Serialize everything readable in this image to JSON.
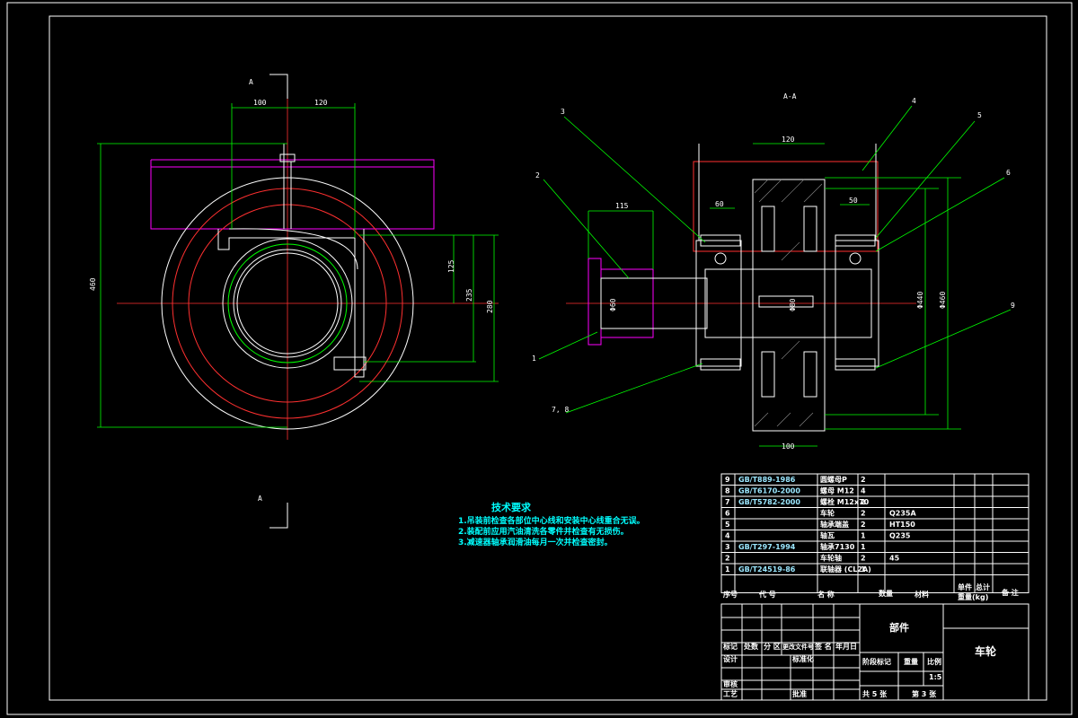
{
  "section_marks": {
    "top": "A",
    "bottom": "A",
    "view_title": "A-A"
  },
  "left_view_dims": {
    "d1": "100",
    "d2": "120",
    "h_total": "460",
    "h1": "125",
    "h2": "235",
    "h3": "280"
  },
  "right_view_dims": {
    "top_width": "120",
    "w_left_brg": "60",
    "w_right_brg": "50",
    "shaft": "115",
    "h_a": "Φ440",
    "h_b": "Φ460",
    "bottom_width": "100",
    "shaft_dia_left": "Φ60",
    "shaft_dia_mid": "Φ80"
  },
  "leaders": [
    "3",
    "4",
    "5",
    "6",
    "2",
    "1",
    "7, 8",
    "9"
  ],
  "tech_requirements": {
    "title": "技术要求",
    "lines": [
      "1.吊装前检查各部位中心线和安装中心线重合无误。",
      "2.装配前应用汽油清洗各零件并检查有无损伤。",
      "3.减速器轴承润滑油每月一次并检查密封。"
    ]
  },
  "bom": {
    "rows": [
      {
        "no": "9",
        "code": "GB/T889-1986",
        "name": "圆螺母P",
        "qty": "2",
        "material": "",
        "weight": "",
        "remark": ""
      },
      {
        "no": "8",
        "code": "GB/T6170-2000",
        "name": "螺母 M12",
        "qty": "4",
        "material": "",
        "weight": "",
        "remark": ""
      },
      {
        "no": "7",
        "code": "GB/T5782-2000",
        "name": "螺栓 M12x70",
        "qty": "2",
        "material": "",
        "weight": "",
        "remark": ""
      },
      {
        "no": "6",
        "code": "",
        "name": "车轮",
        "qty": "2",
        "material": "Q235A",
        "weight": "",
        "remark": ""
      },
      {
        "no": "5",
        "code": "",
        "name": "轴承端盖",
        "qty": "2",
        "material": "HT150",
        "weight": "",
        "remark": ""
      },
      {
        "no": "4",
        "code": "",
        "name": "轴瓦",
        "qty": "1",
        "material": "Q235",
        "weight": "",
        "remark": ""
      },
      {
        "no": "3",
        "code": "GB/T297-1994",
        "name": "轴承7130",
        "qty": "1",
        "material": "",
        "weight": "",
        "remark": ""
      },
      {
        "no": "2",
        "code": "",
        "name": "车轮轴",
        "qty": "2",
        "material": "45",
        "weight": "",
        "remark": ""
      },
      {
        "no": "1",
        "code": "GB/T24519-86",
        "name": "联轴器 (CL2A)",
        "qty": "1",
        "material": "",
        "weight": "",
        "remark": ""
      }
    ],
    "headers": {
      "no": "序号",
      "code": "代 号",
      "name": "名 称",
      "qty": "数量",
      "material": "材料",
      "unit_weight": "单件",
      "total_weight": "总计",
      "weight_label": "重量(kg)",
      "remark": "备 注"
    }
  },
  "title_block": {
    "labels": {
      "mark": "标记",
      "count": "处数",
      "zone": "分 区",
      "doc": "更改文件号",
      "sign": "签 名",
      "date": "年月日",
      "design": "设计",
      "standard": "标准化",
      "review": "审核",
      "process": "工艺",
      "approve": "批准",
      "stage": "阶段标记",
      "weight": "重量",
      "scale": "比例"
    },
    "values": {
      "scale": "1:5",
      "sheet_total": "共 5 张",
      "sheet_no": "第 3 张",
      "part_name": "部件",
      "drawing_title": "车轮"
    }
  }
}
